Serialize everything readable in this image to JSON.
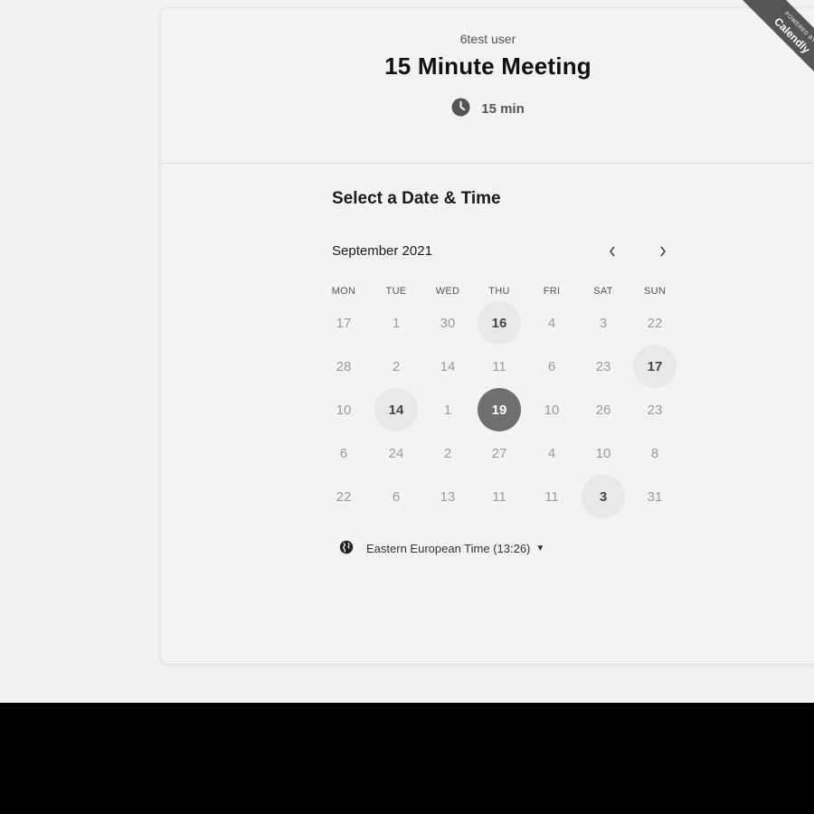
{
  "event": {
    "host": "6test user",
    "title": "15 Minute Meeting",
    "duration": "15 min",
    "icon": "clock-icon"
  },
  "scheduler": {
    "section_title": "Select a Date & Time",
    "month": "September 2021",
    "prev_icon": "chevron-left-icon",
    "next_icon": "chevron-right-icon",
    "weekdays": [
      "MON",
      "TUE",
      "WED",
      "THU",
      "FRI",
      "SAT",
      "SUN"
    ],
    "weeks": [
      [
        {
          "label": "17",
          "state": "disabled"
        },
        {
          "label": "1",
          "state": "disabled"
        },
        {
          "label": "30",
          "state": "disabled"
        },
        {
          "label": "16",
          "state": "available"
        },
        {
          "label": "4",
          "state": "disabled"
        },
        {
          "label": "3",
          "state": "disabled"
        },
        {
          "label": "22",
          "state": "disabled"
        }
      ],
      [
        {
          "label": "28",
          "state": "disabled"
        },
        {
          "label": "2",
          "state": "disabled"
        },
        {
          "label": "14",
          "state": "disabled"
        },
        {
          "label": "11",
          "state": "disabled"
        },
        {
          "label": "6",
          "state": "disabled"
        },
        {
          "label": "23",
          "state": "disabled"
        },
        {
          "label": "17",
          "state": "available"
        }
      ],
      [
        {
          "label": "10",
          "state": "disabled"
        },
        {
          "label": "14",
          "state": "available"
        },
        {
          "label": "1",
          "state": "disabled"
        },
        {
          "label": "19",
          "state": "selected"
        },
        {
          "label": "10",
          "state": "disabled"
        },
        {
          "label": "26",
          "state": "disabled"
        },
        {
          "label": "23",
          "state": "disabled"
        }
      ],
      [
        {
          "label": "6",
          "state": "disabled"
        },
        {
          "label": "24",
          "state": "disabled"
        },
        {
          "label": "2",
          "state": "disabled"
        },
        {
          "label": "27",
          "state": "disabled"
        },
        {
          "label": "4",
          "state": "disabled"
        },
        {
          "label": "10",
          "state": "disabled"
        },
        {
          "label": "8",
          "state": "disabled"
        }
      ],
      [
        {
          "label": "22",
          "state": "disabled"
        },
        {
          "label": "6",
          "state": "disabled"
        },
        {
          "label": "13",
          "state": "disabled"
        },
        {
          "label": "11",
          "state": "disabled"
        },
        {
          "label": "11",
          "state": "disabled"
        },
        {
          "label": "3",
          "state": "available"
        },
        {
          "label": "31",
          "state": "disabled"
        }
      ]
    ],
    "timezone": {
      "label": "Eastern European Time (13:26)",
      "icon": "globe-icon",
      "caret_icon": "caret-down-icon"
    }
  },
  "badge": {
    "powered_text": "POWERED BY",
    "brand": "Calendly"
  },
  "colors": {
    "page_background": "#f2f2f2",
    "card_background": "#f3f3f3",
    "selected_day": "#6f6f6f",
    "available_day": "#e8e8e8",
    "ribbon": "#555555"
  }
}
